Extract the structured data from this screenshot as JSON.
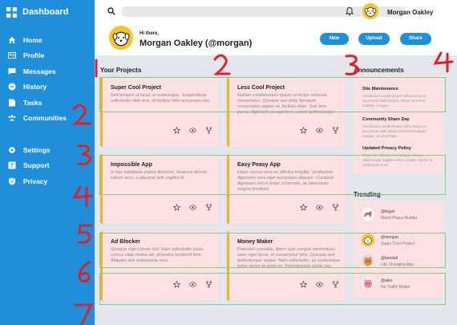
{
  "sidebar": {
    "title": "Dashboard",
    "items": [
      {
        "label": "Home",
        "icon": "home-icon"
      },
      {
        "label": "Profile",
        "icon": "profile-icon"
      },
      {
        "label": "Messages",
        "icon": "messages-icon"
      },
      {
        "label": "History",
        "icon": "history-icon"
      },
      {
        "label": "Tasks",
        "icon": "tasks-icon"
      },
      {
        "label": "Communities",
        "icon": "communities-icon"
      }
    ],
    "bottom_items": [
      {
        "label": "Settings",
        "icon": "settings-icon"
      },
      {
        "label": "Support",
        "icon": "support-icon"
      },
      {
        "label": "Privacy",
        "icon": "privacy-icon"
      }
    ]
  },
  "topbar": {
    "search_placeholder": "",
    "user_name": "Morgan Oakley"
  },
  "header": {
    "greeting": "Hi there,",
    "name_handle": "Morgan Oakley (@morgan)",
    "buttons": [
      "New",
      "Upload",
      "Share"
    ]
  },
  "projects": {
    "title": "Your Projects",
    "cards": [
      {
        "title": "Super Cool Project",
        "desc": "Sed tempus ut lacus ut scelerisque. Suspendisse sollicitudin nibh erat, id facilisis felis accumsan nec."
      },
      {
        "title": "Less Cool Project",
        "desc": "Nullam condimentum ipsum ut lectus vehicula consectetur. Quisque sed dolor tincidunt, consectetur sapien et, facilisis dolor. Sed sem purus, dignissim ut sapien in, rutrum pellentesque lacus."
      },
      {
        "title": "Impossible App",
        "desc": "In hac habitasse platea dictumst. Vivamus dictum rutrum arcu, a placerat velit sagittis id."
      },
      {
        "title": "Easy Peasy App",
        "desc": "Etiam cursus eros ac efficitur fringilla. Vestibulum dignissim urna eget accumsan aliquam. Curabitur dignissim nisi in tortor commodo, ac bibendum magna tincidunt."
      },
      {
        "title": "Ad Blocker",
        "desc": "Quisque eget rutrum nisl. Nam sollicitudin justo, cursus vitae metus vel, pharetra hendrerit felis. Aliquam sed malesuada eros."
      },
      {
        "title": "Money Maker",
        "desc": "Praesent convallis, libero quis congue elementum, nunc eget lacus, et consectetur felis. Quisque sed pellentesque augue. Nam sollicitudin, ac scelerisque tortor purus sit amet ex. Pellentesque mollis nec enim vel dapibus."
      }
    ]
  },
  "announcements": {
    "title": "Announcements",
    "items": [
      {
        "title": "Site Maintenance",
        "text": "Vestibulum condimentum tellus lacus, in accumsan velit facilisis. Etiam hendrerit sodales congue."
      },
      {
        "title": "Community Share Day",
        "text": "Vestibulum condimentum tellus lacus, in accumsan velit. Etiam hendrerit sodales congue, sit ut pretium."
      },
      {
        "title": "Updated Privacy Policy",
        "text": "Phasellus efficitur nisi sit ligula. Donec ullamcorper sagittis velit in ornare. Donec et vestibulum eros."
      }
    ]
  },
  "trending": {
    "title": "Trending",
    "items": [
      {
        "user": "@tegan",
        "text": "World Peace Builder"
      },
      {
        "user": "@morgan",
        "text": "Super Cool Project"
      },
      {
        "user": "@kendall",
        "text": "Life Changing App"
      },
      {
        "user": "@alex",
        "text": "No Traffic Maker"
      }
    ]
  },
  "overlay_annotations": [
    "1",
    "2",
    "3",
    "4",
    "2",
    "3",
    "4",
    "5",
    "6",
    "7"
  ],
  "colors": {
    "sidebar": "#1e8fd8",
    "accent": "#1e8fd8",
    "card_bg": "#fde1e2",
    "card_stripe": "#f0b429",
    "main_bg": "#e4e6eb",
    "annotation_red": "#e0202a",
    "annotation_green": "#7fcf8a"
  }
}
